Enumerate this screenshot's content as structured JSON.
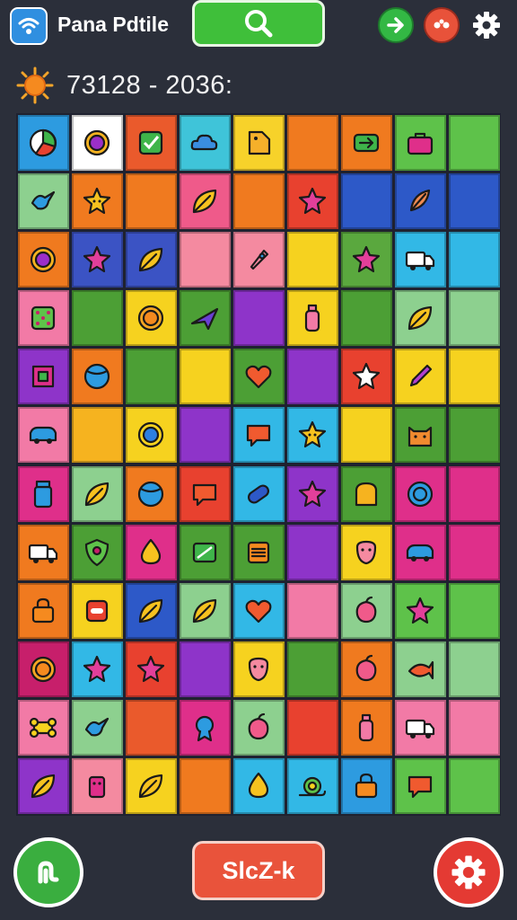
{
  "header": {
    "app_title": "Pana Pdtile",
    "logo_icon": "wifi-badge-icon",
    "search_icon": "search-icon",
    "next_icon": "arrow-right-icon",
    "favorites_icon": "dots-icon",
    "settings_icon": "gear-icon"
  },
  "score": {
    "sun_icon": "sun-icon",
    "text": "73128 - 2036:"
  },
  "board": {
    "columns": 9,
    "rows": 12,
    "tiles": [
      [
        "#2d9be0",
        "pie-icon"
      ],
      [
        "#ffffff",
        "sun-purple-icon"
      ],
      [
        "#ea5a2c",
        "check-icon"
      ],
      [
        "#3fc4d9",
        "cloud-icon"
      ],
      [
        "#f7d22a",
        "tag-icon"
      ],
      [
        "#f07a1f",
        ""
      ],
      [
        "#f07a1f",
        "arrow-badge-icon"
      ],
      [
        "#5ec24a",
        "bag-icon"
      ],
      [
        "#5ec24a",
        ""
      ],
      [
        "#8dd08f",
        "bird-icon"
      ],
      [
        "#f07a1f",
        "star-face-icon"
      ],
      [
        "#f07a1f",
        ""
      ],
      [
        "#ef5a8a",
        "leaf-icon"
      ],
      [
        "#f07a1f",
        ""
      ],
      [
        "#e8412f",
        "star-icon"
      ],
      [
        "#2d59c8",
        ""
      ],
      [
        "#2d59c8",
        "feather-icon"
      ],
      [
        "#2d59c8",
        ""
      ],
      [
        "#f07a1f",
        "sun-purple-icon"
      ],
      [
        "#3b53c4",
        "star-icon"
      ],
      [
        "#3b53c4",
        "leaf-icon"
      ],
      [
        "#f48aa0",
        ""
      ],
      [
        "#f48aa0",
        "rocket-icon"
      ],
      [
        "#f6d21f",
        ""
      ],
      [
        "#5aa83e",
        "star-icon"
      ],
      [
        "#32b8e6",
        "truck-icon"
      ],
      [
        "#32b8e6",
        ""
      ],
      [
        "#f27aa6",
        "dice-icon"
      ],
      [
        "#4c9f35",
        ""
      ],
      [
        "#f6d21f",
        "sun-icon"
      ],
      [
        "#4c9f35",
        "plane-icon"
      ],
      [
        "#8e34c9",
        ""
      ],
      [
        "#f6d21f",
        "bottle-icon"
      ],
      [
        "#4c9f35",
        ""
      ],
      [
        "#8dd08f",
        "leaf-icon"
      ],
      [
        "#8dd08f",
        ""
      ],
      [
        "#8e34c9",
        "square-icon"
      ],
      [
        "#f07a1f",
        "ball-icon"
      ],
      [
        "#4c9f35",
        ""
      ],
      [
        "#f6d21f",
        ""
      ],
      [
        "#4c9f35",
        "heart-icon"
      ],
      [
        "#8e34c9",
        ""
      ],
      [
        "#e8412f",
        "star-white-icon"
      ],
      [
        "#f6d21f",
        "pencil-icon"
      ],
      [
        "#f6d21f",
        ""
      ],
      [
        "#f27aa6",
        "car-icon"
      ],
      [
        "#f6b31f",
        ""
      ],
      [
        "#f6d21f",
        "sun-blue-icon"
      ],
      [
        "#8e34c9",
        ""
      ],
      [
        "#32b8e6",
        "chat-icon"
      ],
      [
        "#32b8e6",
        "star-face-icon"
      ],
      [
        "#f6d21f",
        ""
      ],
      [
        "#4c9f35",
        "cat-icon"
      ],
      [
        "#4c9f35",
        ""
      ],
      [
        "#df2f8a",
        "jar-icon"
      ],
      [
        "#8dd08f",
        "leaf-icon"
      ],
      [
        "#f07a1f",
        "ball-icon"
      ],
      [
        "#e8412f",
        "chat-icon"
      ],
      [
        "#32b8e6",
        "pill-icon"
      ],
      [
        "#8e34c9",
        "star-icon"
      ],
      [
        "#4c9f35",
        "toast-icon"
      ],
      [
        "#df2f8a",
        "swirl-icon"
      ],
      [
        "#df2f8a",
        ""
      ],
      [
        "#f07a1f",
        "truck-icon"
      ],
      [
        "#4c9f35",
        "shield-icon"
      ],
      [
        "#df2f8a",
        "drop-icon"
      ],
      [
        "#4c9f35",
        "card-icon"
      ],
      [
        "#4c9f35",
        "chip-icon"
      ],
      [
        "#8e34c9",
        ""
      ],
      [
        "#f6d21f",
        "face-icon"
      ],
      [
        "#df2f8a",
        "car-icon"
      ],
      [
        "#df2f8a",
        ""
      ],
      [
        "#f07a1f",
        "lock-icon"
      ],
      [
        "#f6d21f",
        "tile-icon"
      ],
      [
        "#2d59c8",
        "leaf-icon"
      ],
      [
        "#8dd08f",
        "leaf-icon"
      ],
      [
        "#32b8e6",
        "heart-icon"
      ],
      [
        "#f27aa6",
        ""
      ],
      [
        "#8dd08f",
        "fruit-icon"
      ],
      [
        "#5ec24a",
        "star-icon"
      ],
      [
        "#5ec24a",
        ""
      ],
      [
        "#c71f6b",
        "sun-icon"
      ],
      [
        "#32b8e6",
        "star-icon"
      ],
      [
        "#e8412f",
        "star-icon"
      ],
      [
        "#8e34c9",
        ""
      ],
      [
        "#f6d21f",
        "face-icon"
      ],
      [
        "#4c9f35",
        ""
      ],
      [
        "#f07a1f",
        "fruit-icon"
      ],
      [
        "#8dd08f",
        "fish-icon"
      ],
      [
        "#8dd08f",
        ""
      ],
      [
        "#f27aa6",
        "bone-icon"
      ],
      [
        "#8dd08f",
        "bird-icon"
      ],
      [
        "#ea5a2c",
        ""
      ],
      [
        "#df2f8a",
        "ribbon-icon"
      ],
      [
        "#8dd08f",
        "fruit-icon"
      ],
      [
        "#e8412f",
        ""
      ],
      [
        "#f07a1f",
        "bottle-icon"
      ],
      [
        "#f27aa6",
        "truck-icon"
      ],
      [
        "#f27aa6",
        ""
      ],
      [
        "#8e34c9",
        "leaf-icon"
      ],
      [
        "#f48aa0",
        "robot-icon"
      ],
      [
        "#f6d21f",
        "leaf-icon"
      ],
      [
        "#f07a1f",
        ""
      ],
      [
        "#32b8e6",
        "drop-icon"
      ],
      [
        "#32b8e6",
        "snail-icon"
      ],
      [
        "#2d9be0",
        "lock-icon"
      ],
      [
        "#5ec24a",
        "chat-icon"
      ],
      [
        "#5ec24a",
        ""
      ]
    ]
  },
  "footer": {
    "home_icon": "home-icon",
    "action_label": "SlcZ-k",
    "settings_icon": "gear-icon"
  }
}
